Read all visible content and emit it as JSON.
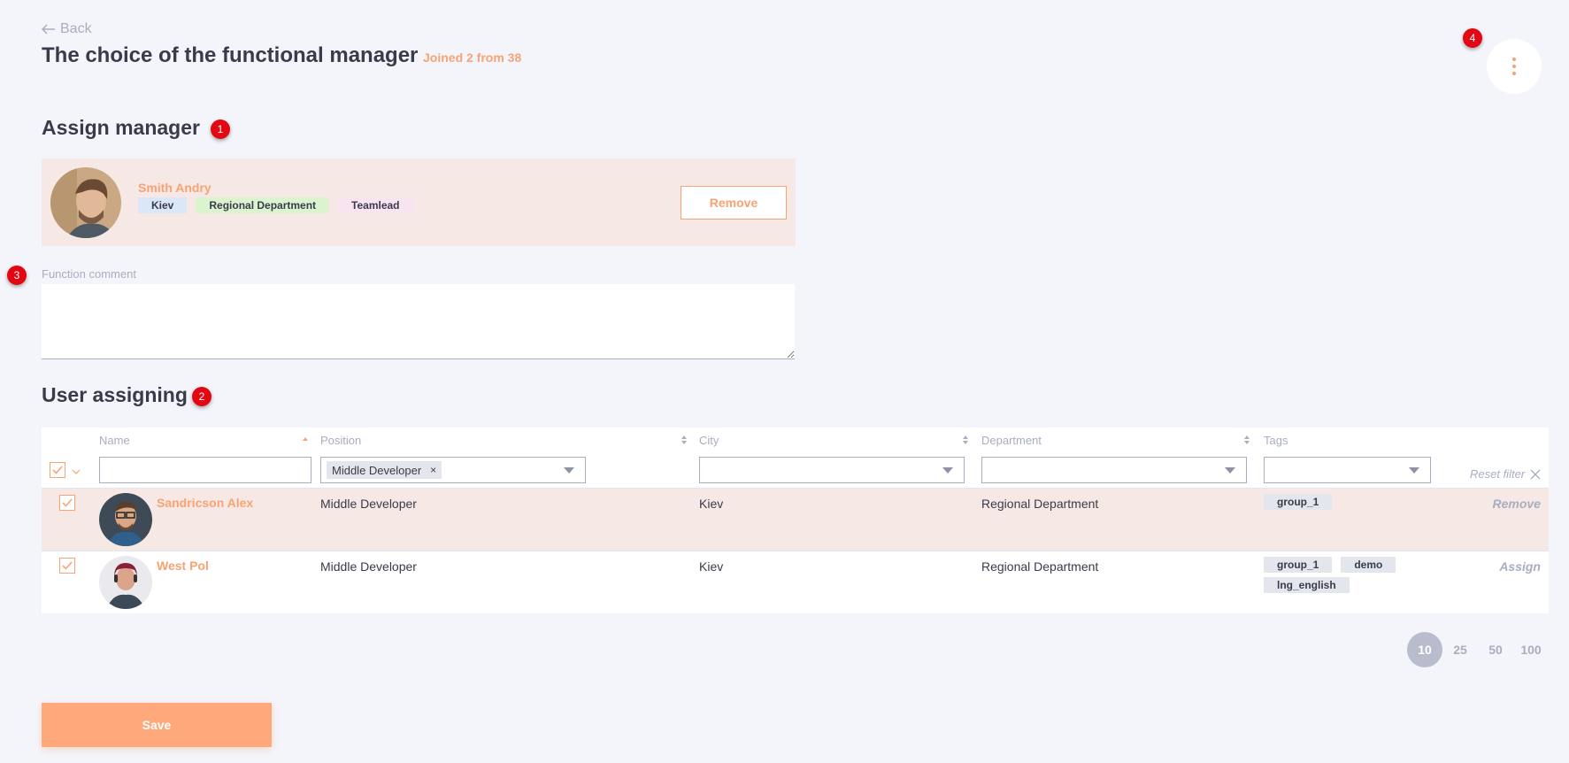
{
  "header": {
    "back_label": "Back",
    "title": "The choice of the functional manager",
    "joined_text": "Joined 2 from 38"
  },
  "badges": [
    "1",
    "2",
    "3",
    "4"
  ],
  "assign_manager": {
    "title": "Assign manager",
    "manager": {
      "name": "Smith Andry",
      "tags": [
        "Kiev",
        "Regional Department",
        "Teamlead"
      ]
    },
    "remove_label": "Remove"
  },
  "comment": {
    "label": "Function comment",
    "value": ""
  },
  "user_assigning": {
    "title": "User assigning",
    "columns": [
      "Name",
      "Position",
      "City",
      "Department",
      "Tags"
    ],
    "filters": {
      "name": "",
      "position_chip": "Middle Developer",
      "position_chip_remove": "×",
      "city": "",
      "department": "",
      "tags": ""
    },
    "reset_filter_label": "Reset filter",
    "rows": [
      {
        "name": "Sandricson Alex",
        "position": "Middle Developer",
        "city": "Kiev",
        "department": "Regional Department",
        "tags": [
          "group_1"
        ],
        "action": "Remove",
        "selected": true
      },
      {
        "name": "West Pol",
        "position": "Middle Developer",
        "city": "Kiev",
        "department": "Regional Department",
        "tags": [
          "group_1",
          "demo",
          "lng_english"
        ],
        "action": "Assign",
        "selected": false
      }
    ]
  },
  "pagination": {
    "sizes": [
      "10",
      "25",
      "50",
      "100"
    ],
    "active": "10"
  },
  "save_label": "Save",
  "colors": {
    "accent": "#f9a274",
    "background": "#f4f5fa",
    "selected_row": "#f6e9e5",
    "badge": "#e30613"
  }
}
